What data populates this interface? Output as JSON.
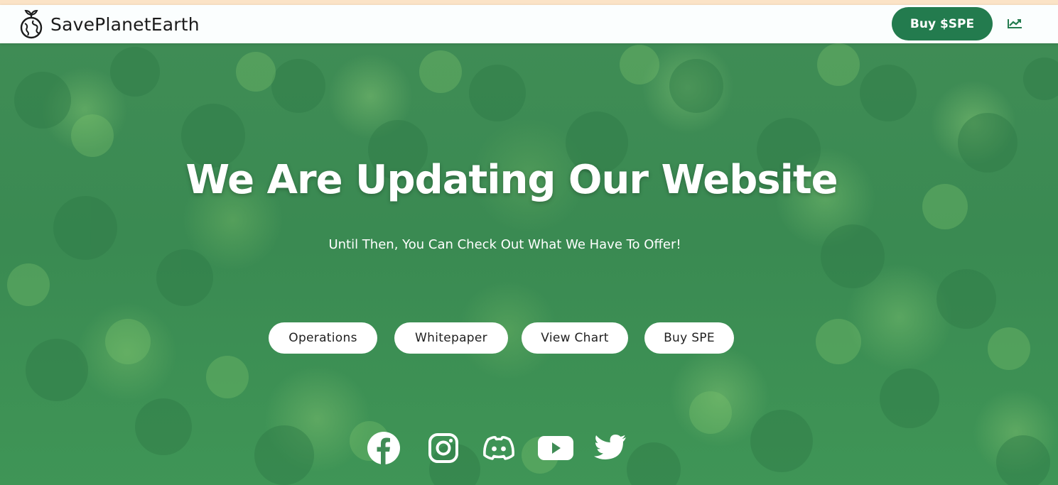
{
  "header": {
    "brand_name": "SavePlanetEarth",
    "buy_button_label": "Buy $SPE",
    "logo_icon": "planet-sprout-icon",
    "chart_icon": "trending-chart-icon"
  },
  "hero": {
    "headline": "We Are Updating Our Website",
    "subtitle": "Until Then, You Can Check Out What We Have To Offer!",
    "buttons": [
      {
        "label": "Operations"
      },
      {
        "label": "Whitepaper"
      },
      {
        "label": "View Chart"
      },
      {
        "label": "Buy SPE"
      }
    ],
    "social_icons": [
      "facebook-icon",
      "instagram-icon",
      "discord-icon",
      "youtube-icon",
      "twitter-icon"
    ]
  },
  "colors": {
    "accent_green": "#237b4e",
    "navbar_bg": "#fbfefe",
    "top_strip": "#fbe3c6",
    "hero_green": "#3f8c55"
  }
}
